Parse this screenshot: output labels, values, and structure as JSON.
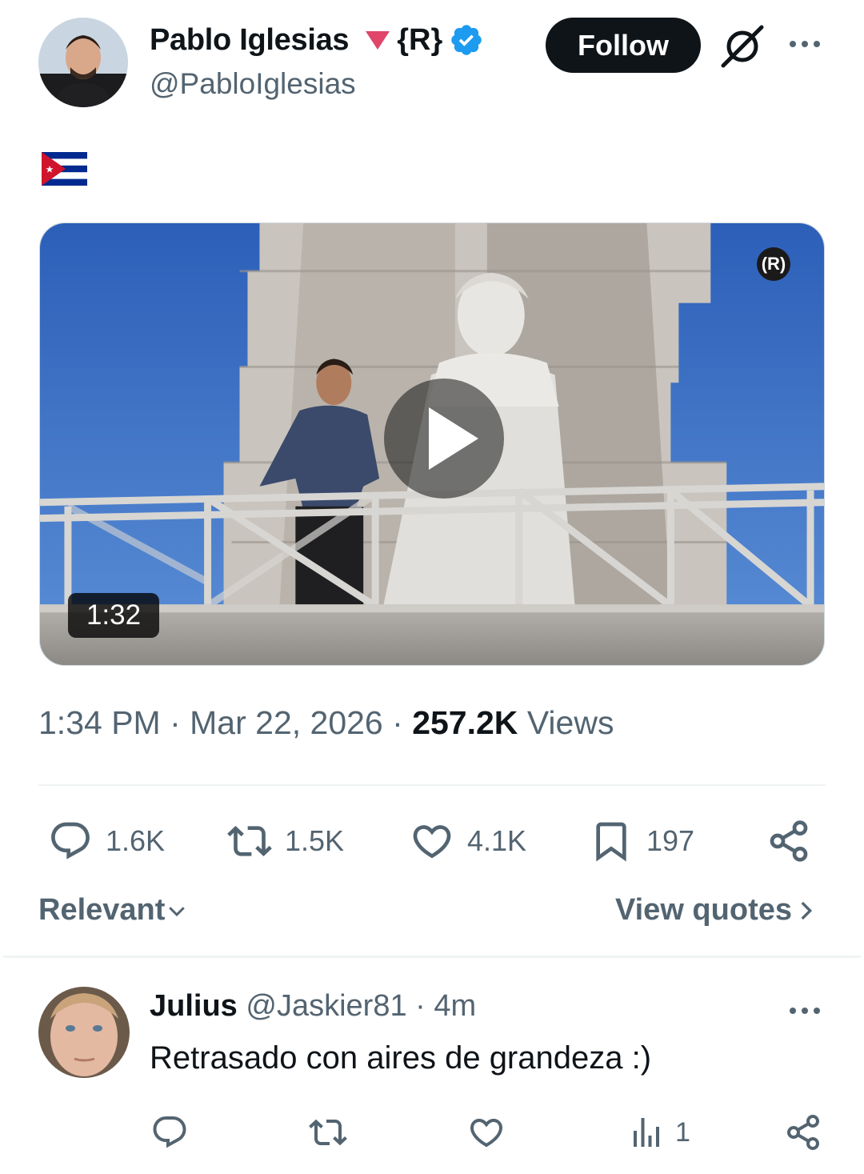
{
  "author": {
    "name": "Pablo Iglesias",
    "name_suffix": "{R}",
    "handle": "@PabloIglesias",
    "follow_label": "Follow"
  },
  "post": {
    "flag_emoji": "cuba-flag",
    "video_duration": "1:32",
    "watermark": "(R)",
    "time": "1:34 PM",
    "date": "Mar 22, 2026",
    "views_count": "257.2K",
    "views_label": "Views"
  },
  "stats": {
    "replies": "1.6K",
    "reposts": "1.5K",
    "likes": "4.1K",
    "bookmarks": "197"
  },
  "sort": {
    "relevant_label": "Relevant",
    "view_quotes_label": "View quotes"
  },
  "reply": {
    "name": "Julius",
    "handle": "@Jaskier81",
    "time": "4m",
    "text": "Retrasado con aires de grandeza :)",
    "views": "1"
  },
  "colors": {
    "accent_blue": "#1d9bf0",
    "text_primary": "#0f1419",
    "text_secondary": "#536471",
    "podemos_purple": "#e0456a"
  },
  "icons": [
    "verified-badge-icon",
    "grok-icon",
    "more-icon",
    "reply-icon",
    "repost-icon",
    "like-icon",
    "bookmark-icon",
    "share-icon",
    "views-icon",
    "chevron-down-icon",
    "chevron-right-icon",
    "play-icon"
  ]
}
